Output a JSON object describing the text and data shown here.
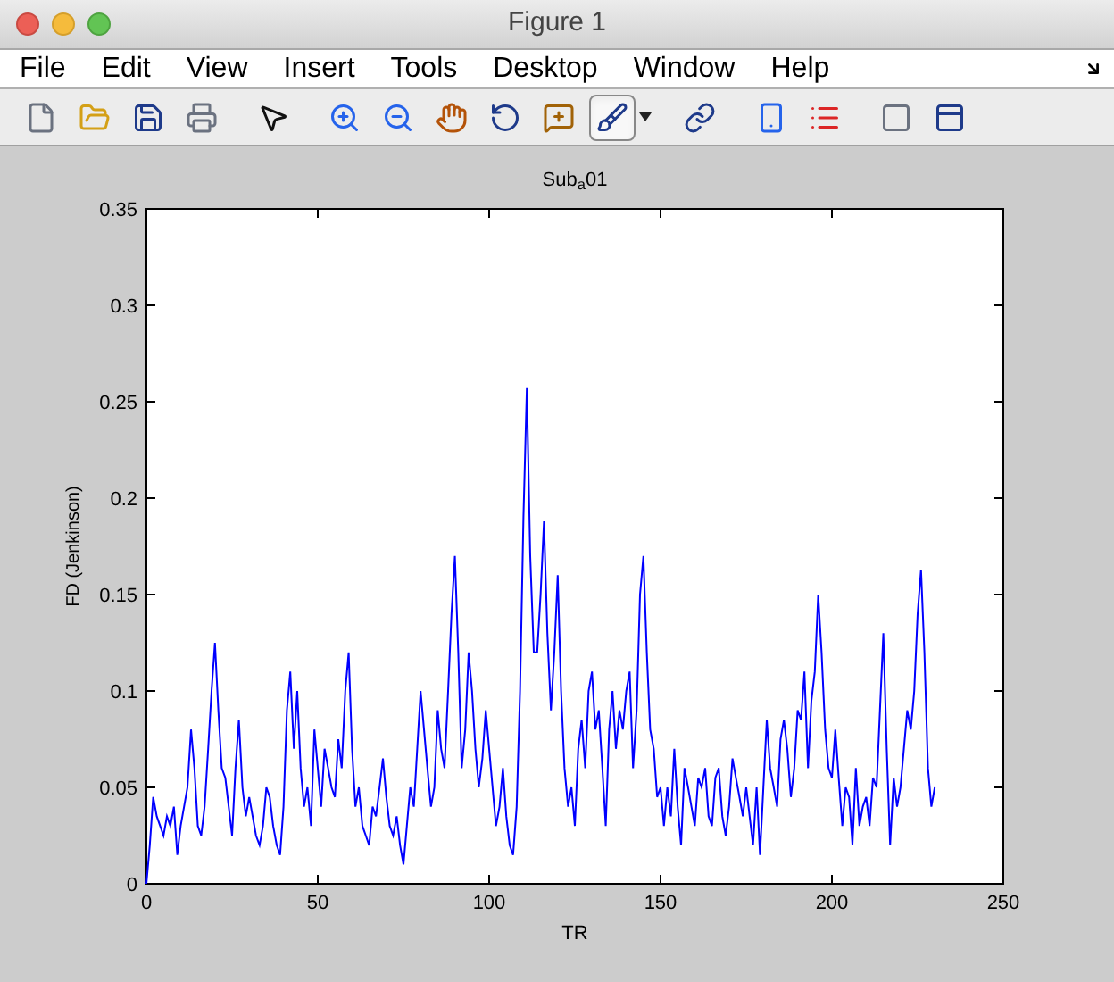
{
  "window": {
    "title": "Figure 1"
  },
  "menu": [
    "File",
    "Edit",
    "View",
    "Insert",
    "Tools",
    "Desktop",
    "Window",
    "Help"
  ],
  "toolbar": [
    {
      "kind": "new",
      "on": false
    },
    {
      "kind": "open",
      "on": false
    },
    {
      "kind": "save",
      "on": false
    },
    {
      "kind": "print",
      "on": false
    },
    {
      "kind": "pointer",
      "on": false
    },
    {
      "kind": "zoomin",
      "on": false
    },
    {
      "kind": "zoomout",
      "on": false
    },
    {
      "kind": "pan",
      "on": false
    },
    {
      "kind": "rotate",
      "on": false
    },
    {
      "kind": "datacursor",
      "on": false
    },
    {
      "kind": "brush",
      "on": true
    },
    {
      "kind": "dropdown",
      "on": false
    },
    {
      "kind": "link",
      "on": false
    },
    {
      "kind": "colorbar",
      "on": false
    },
    {
      "kind": "legend",
      "on": false
    },
    {
      "kind": "hide",
      "on": false
    },
    {
      "kind": "dock",
      "on": false
    }
  ],
  "chart_data": {
    "type": "line",
    "title": "Sub$_{a}$01",
    "xlabel": "TR",
    "ylabel": "FD (Jenkinson)",
    "x": [
      0,
      1,
      2,
      3,
      4,
      5,
      6,
      7,
      8,
      9,
      10,
      11,
      12,
      13,
      14,
      15,
      16,
      17,
      18,
      19,
      20,
      21,
      22,
      23,
      24,
      25,
      26,
      27,
      28,
      29,
      30,
      31,
      32,
      33,
      34,
      35,
      36,
      37,
      38,
      39,
      40,
      41,
      42,
      43,
      44,
      45,
      46,
      47,
      48,
      49,
      50,
      51,
      52,
      53,
      54,
      55,
      56,
      57,
      58,
      59,
      60,
      61,
      62,
      63,
      64,
      65,
      66,
      67,
      68,
      69,
      70,
      71,
      72,
      73,
      74,
      75,
      76,
      77,
      78,
      79,
      80,
      81,
      82,
      83,
      84,
      85,
      86,
      87,
      88,
      89,
      90,
      91,
      92,
      93,
      94,
      95,
      96,
      97,
      98,
      99,
      100,
      101,
      102,
      103,
      104,
      105,
      106,
      107,
      108,
      109,
      110,
      111,
      112,
      113,
      114,
      115,
      116,
      117,
      118,
      119,
      120,
      121,
      122,
      123,
      124,
      125,
      126,
      127,
      128,
      129,
      130,
      131,
      132,
      133,
      134,
      135,
      136,
      137,
      138,
      139,
      140,
      141,
      142,
      143,
      144,
      145,
      146,
      147,
      148,
      149,
      150,
      151,
      152,
      153,
      154,
      155,
      156,
      157,
      158,
      159,
      160,
      161,
      162,
      163,
      164,
      165,
      166,
      167,
      168,
      169,
      170,
      171,
      172,
      173,
      174,
      175,
      176,
      177,
      178,
      179,
      180,
      181,
      182,
      183,
      184,
      185,
      186,
      187,
      188,
      189,
      190,
      191,
      192,
      193,
      194,
      195,
      196,
      197,
      198,
      199,
      200,
      201,
      202,
      203,
      204,
      205,
      206,
      207,
      208,
      209,
      210,
      211,
      212,
      213,
      214,
      215,
      216,
      217,
      218,
      219,
      220,
      221,
      222,
      223,
      224,
      225,
      226,
      227,
      228,
      229,
      230
    ],
    "xlim": [
      0,
      250
    ],
    "ylim": [
      0,
      0.35
    ],
    "xticks": [
      0,
      50,
      100,
      150,
      200,
      250
    ],
    "yticks": [
      0,
      0.05,
      0.1,
      0.15,
      0.2,
      0.25,
      0.3,
      0.35
    ],
    "series": [
      {
        "color": "#0000ff",
        "values": [
          0,
          0.02,
          0.045,
          0.035,
          0.03,
          0.025,
          0.035,
          0.03,
          0.04,
          0.015,
          0.03,
          0.04,
          0.05,
          0.08,
          0.06,
          0.03,
          0.025,
          0.04,
          0.07,
          0.1,
          0.125,
          0.09,
          0.06,
          0.055,
          0.04,
          0.025,
          0.06,
          0.085,
          0.05,
          0.035,
          0.045,
          0.035,
          0.025,
          0.02,
          0.03,
          0.05,
          0.045,
          0.03,
          0.02,
          0.015,
          0.04,
          0.09,
          0.11,
          0.07,
          0.1,
          0.06,
          0.04,
          0.05,
          0.03,
          0.08,
          0.06,
          0.04,
          0.07,
          0.06,
          0.05,
          0.045,
          0.075,
          0.06,
          0.1,
          0.12,
          0.07,
          0.04,
          0.05,
          0.03,
          0.025,
          0.02,
          0.04,
          0.035,
          0.05,
          0.065,
          0.045,
          0.03,
          0.025,
          0.035,
          0.02,
          0.01,
          0.03,
          0.05,
          0.04,
          0.07,
          0.1,
          0.08,
          0.06,
          0.04,
          0.05,
          0.09,
          0.07,
          0.06,
          0.1,
          0.14,
          0.17,
          0.12,
          0.06,
          0.08,
          0.12,
          0.1,
          0.07,
          0.05,
          0.065,
          0.09,
          0.07,
          0.05,
          0.03,
          0.04,
          0.06,
          0.035,
          0.02,
          0.015,
          0.04,
          0.1,
          0.19,
          0.257,
          0.17,
          0.12,
          0.12,
          0.15,
          0.188,
          0.13,
          0.09,
          0.12,
          0.16,
          0.1,
          0.06,
          0.04,
          0.05,
          0.03,
          0.07,
          0.085,
          0.06,
          0.1,
          0.11,
          0.08,
          0.09,
          0.06,
          0.03,
          0.08,
          0.1,
          0.07,
          0.09,
          0.08,
          0.1,
          0.11,
          0.06,
          0.09,
          0.15,
          0.17,
          0.12,
          0.08,
          0.07,
          0.045,
          0.05,
          0.03,
          0.05,
          0.035,
          0.07,
          0.04,
          0.02,
          0.06,
          0.05,
          0.04,
          0.03,
          0.055,
          0.05,
          0.06,
          0.035,
          0.03,
          0.055,
          0.06,
          0.035,
          0.025,
          0.04,
          0.065,
          0.055,
          0.045,
          0.035,
          0.05,
          0.035,
          0.02,
          0.05,
          0.015,
          0.05,
          0.085,
          0.06,
          0.05,
          0.04,
          0.075,
          0.085,
          0.07,
          0.045,
          0.06,
          0.09,
          0.085,
          0.11,
          0.06,
          0.095,
          0.11,
          0.15,
          0.12,
          0.08,
          0.06,
          0.055,
          0.08,
          0.055,
          0.03,
          0.05,
          0.045,
          0.02,
          0.06,
          0.03,
          0.04,
          0.045,
          0.03,
          0.055,
          0.05,
          0.09,
          0.13,
          0.07,
          0.02,
          0.055,
          0.04,
          0.05,
          0.07,
          0.09,
          0.08,
          0.1,
          0.14,
          0.163,
          0.12,
          0.06,
          0.04,
          0.05
        ]
      }
    ]
  }
}
